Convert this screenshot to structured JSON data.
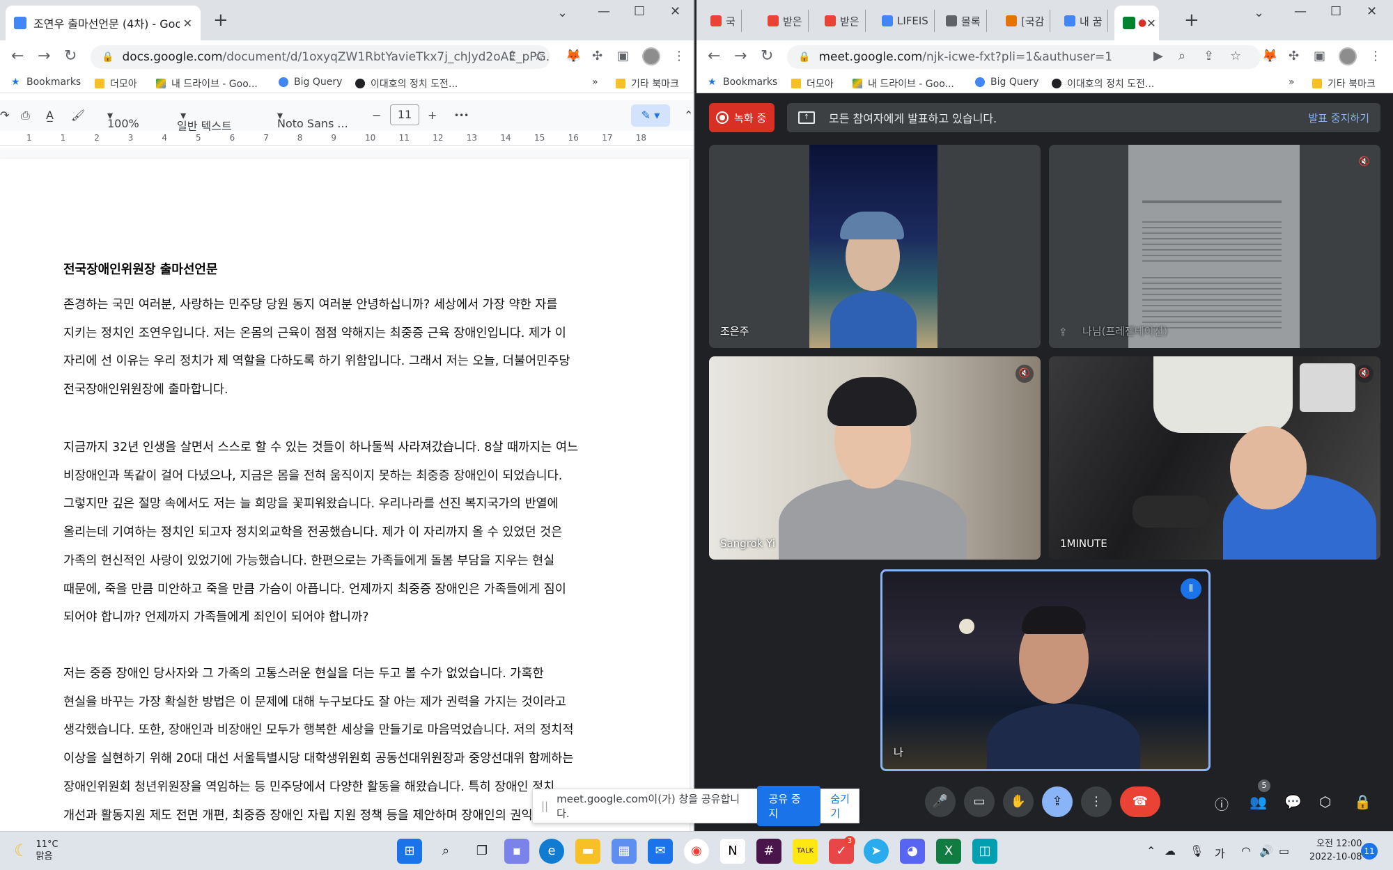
{
  "left_browser": {
    "tab_title": "조연우 출마선언문 (4차) - Goog",
    "url_domain": "docs.google.com",
    "url_path": "/document/d/1oxyqZW1RbtYavieTkx7j_chJyd2oAE_pPG...",
    "bookmarks": [
      "Bookmarks",
      "더모아",
      "내 드라이브 - Goo...",
      "Big Query",
      "이대호의 정치 도전...",
      "»",
      "기타 북마크"
    ],
    "toolbar": {
      "zoom": "100%",
      "style": "일반 텍스트",
      "font": "Noto Sans ...",
      "minus": "−",
      "font_size": "11",
      "plus": "+",
      "more": "•••"
    },
    "ruler_numbers": [
      "1",
      "1",
      "2",
      "3",
      "4",
      "5",
      "6",
      "7",
      "8",
      "9",
      "10",
      "11",
      "12",
      "13",
      "14",
      "15",
      "16",
      "17",
      "18"
    ]
  },
  "document": {
    "title": "전국장애인위원장 출마선언문",
    "paragraphs": [
      [
        "존경하는 국민 여러분, 사랑하는 민주당 당원 동지 여러분 안녕하십니까? 세상에서 가장 약한 자를",
        "지키는 정치인 조연우입니다. 저는 온몸의 근육이 점점 약해지는 최중증 근육 장애인입니다. 제가 이",
        "자리에 선 이유는 우리 정치가 제 역할을 다하도록 하기 위함입니다. 그래서 저는 오늘, 더불어민주당",
        "전국장애인위원장에 출마합니다."
      ],
      [
        "지금까지 32년 인생을 살면서 스스로 할 수 있는 것들이 하나둘씩 사라져갔습니다. 8살 때까지는 여느",
        "비장애인과 똑같이 걸어 다녔으나, 지금은 몸을 전혀 움직이지 못하는 최중증 장애인이 되었습니다.",
        "그렇지만 깊은 절망 속에서도 저는 늘 희망을 꽃피워왔습니다. 우리나라를 선진 복지국가의 반열에",
        "올리는데 기여하는 정치인 되고자 정치외교학을 전공했습니다. 제가 이 자리까지 올 수 있었던 것은",
        "가족의 헌신적인 사랑이 있었기에 가능했습니다. 한편으로는 가족들에게 돌봄 부담을 지우는 현실",
        "때문에, 죽을 만큼 미안하고 죽을 만큼 가슴이 아픕니다. 언제까지 최중증 장애인은 가족들에게 짐이",
        "되어야 합니까? 언제까지 가족들에게 죄인이 되어야 합니까?"
      ],
      [
        "저는 중증 장애인 당사자와 그 가족의 고통스러운 현실을 더는 두고 볼 수가 없었습니다. 가혹한",
        "현실을 바꾸는 가장 확실한 방법은 이 문제에 대해 누구보다도 잘 아는 제가 권력을 가지는 것이라고",
        "생각했습니다. 또한, 장애인과 비장애인 모두가 행복한 세상을 만들기로 마음먹었습니다. 저의 정치적",
        "이상을 실현하기 위해 20대 대선 서울특별시당 대학생위원회 공동선대위원장과 중앙선대위 함께하는",
        "장애인위원회 청년위원장을 역임하는 등 민주당에서 다양한 활동을 해왔습니다. 특히 장애인 정치",
        "개선과 활동지원 제도 전면 개편, 최중증 장애인 자립 지원 정책 등을 제안하며 장애인의 권익 향상을"
      ]
    ]
  },
  "share_bar": {
    "grip": "||",
    "message": "meet.google.com이(가) 창을 공유합니다.",
    "stop": "공유 중지",
    "hide": "숨기기"
  },
  "right_browser": {
    "tabs": [
      "국",
      "받은",
      "받은",
      "LIFEIS",
      "몰록",
      "[국감",
      "내 꿈"
    ],
    "url_domain": "meet.google.com",
    "url_path": "/njk-icwe-fxt?pli=1&authuser=1",
    "bookmarks": [
      "Bookmarks",
      "더모아",
      "내 드라이브 - Goo...",
      "Big Query",
      "이대호의 정치 도전...",
      "»",
      "기타 북마크"
    ]
  },
  "meet": {
    "recording_label": "녹화 중",
    "presenting_text": "모든 참여자에게 발표하고 있습니다.",
    "stop_presenting": "발표 중지하기",
    "participants": [
      {
        "name": "조은주",
        "muted": false
      },
      {
        "name": "나님(프레젠테이션)",
        "muted": true
      },
      {
        "name": "Sangrok Yi",
        "muted": true
      },
      {
        "name": "1MINUTE",
        "muted": true
      },
      {
        "name": "나",
        "muted": false
      }
    ],
    "people_count": "5"
  },
  "taskbar": {
    "temperature": "11°C",
    "weather": "맑음",
    "ime": "가",
    "time": "오전 12:00",
    "date": "2022-10-08",
    "notifications": "11",
    "app_badge": "3"
  }
}
